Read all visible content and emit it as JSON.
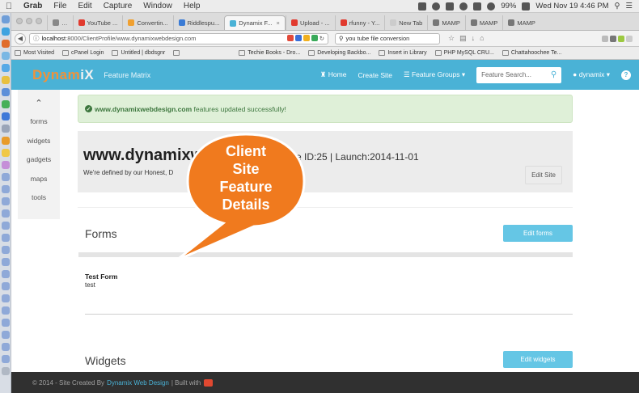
{
  "menubar": {
    "app": "Grab",
    "items": [
      "File",
      "Edit",
      "Capture",
      "Window",
      "Help"
    ],
    "battery": "99%",
    "clock": "Wed Nov 19  4:46 PM"
  },
  "browser": {
    "tabs": [
      {
        "label": "…",
        "color": "#888888"
      },
      {
        "label": "YouTube ...",
        "color": "#e13a2e"
      },
      {
        "label": "Convertin...",
        "color": "#f0a030"
      },
      {
        "label": "Riddlespu...",
        "color": "#3a7bd5"
      },
      {
        "label": "Dynamix F...",
        "color": "#4ab2d6",
        "active": true
      },
      {
        "label": "Upload - ...",
        "color": "#e13a2e"
      },
      {
        "label": "rfunny - Y...",
        "color": "#e13a2e"
      },
      {
        "label": "New Tab",
        "color": "#cccccc"
      },
      {
        "label": "MAMP",
        "color": "#777777"
      },
      {
        "label": "MAMP",
        "color": "#777777"
      },
      {
        "label": "MAMP",
        "color": "#777777"
      }
    ],
    "url_host": "localhost",
    "url_path": ":8000/ClientProfile/www.dynamixwebdesign.com",
    "search_value": "you tube file conversion",
    "bookmarks": [
      "Most Visited",
      "cPanel Login",
      "Untitled | dbdsgnr",
      "",
      "Techie Books - Dro...",
      "Developing Backbo...",
      "Insert in Library",
      "PHP MySQL CRU...",
      "Chattahoochee Te..."
    ]
  },
  "header": {
    "logo_main": "Dynam",
    "logo_x": "iX",
    "subtitle": "Feature Matrix",
    "home": "Home",
    "create_site": "Create Site",
    "feature_groups": "Feature Groups",
    "search_placeholder": "Feature Search...",
    "user": "dynamix",
    "accent_color": "#4ab2d6",
    "logo_color": "#f0923a"
  },
  "sidebar": {
    "items": [
      "forms",
      "widgets",
      "gadgets",
      "maps",
      "tools"
    ]
  },
  "alert": {
    "site": "www.dynamixwebdesign.com",
    "message": "features updated successfully!"
  },
  "site": {
    "name": "www.dynamixw",
    "meta": "e ID:25 | Launch:2014-11-01",
    "tagline": "We're defined by our Honest, D",
    "edit_label": "Edit Site"
  },
  "callout": {
    "lines": [
      "Client",
      "Site",
      "Feature",
      "Details"
    ],
    "color": "#f07a1e"
  },
  "forms": {
    "title": "Forms",
    "edit_label": "Edit forms",
    "items": [
      {
        "name": "Test Form",
        "desc": "test"
      }
    ]
  },
  "widgets": {
    "title": "Widgets",
    "edit_label": "Edit widgets"
  },
  "footer": {
    "prefix": "© 2014 - Site Created By",
    "link": "Dynamix Web Design",
    "suffix": "| Built with"
  }
}
